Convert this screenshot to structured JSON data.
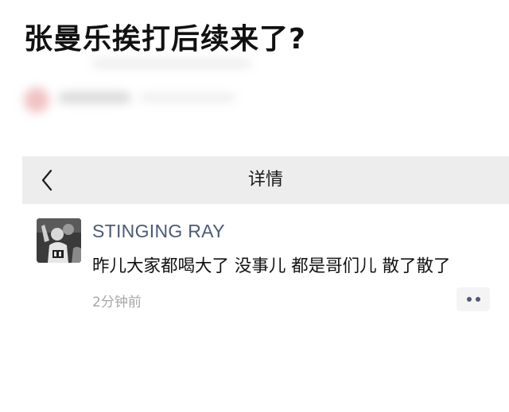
{
  "article": {
    "headline": "张曼乐挨打后续来了?"
  },
  "nav": {
    "back_icon": "chevron-left-icon",
    "title": "详情"
  },
  "comment": {
    "avatar": "user-avatar-photo",
    "username": "STINGING RAY",
    "text": "昨儿大家都喝大了 没事儿 都是哥们儿 散了散了",
    "timestamp": "2分钟前",
    "more_icon": "more-dots-icon"
  },
  "colors": {
    "nav_background": "#ededed",
    "username": "#4b5a77",
    "timestamp": "#a6a6a6",
    "text": "#111111"
  }
}
